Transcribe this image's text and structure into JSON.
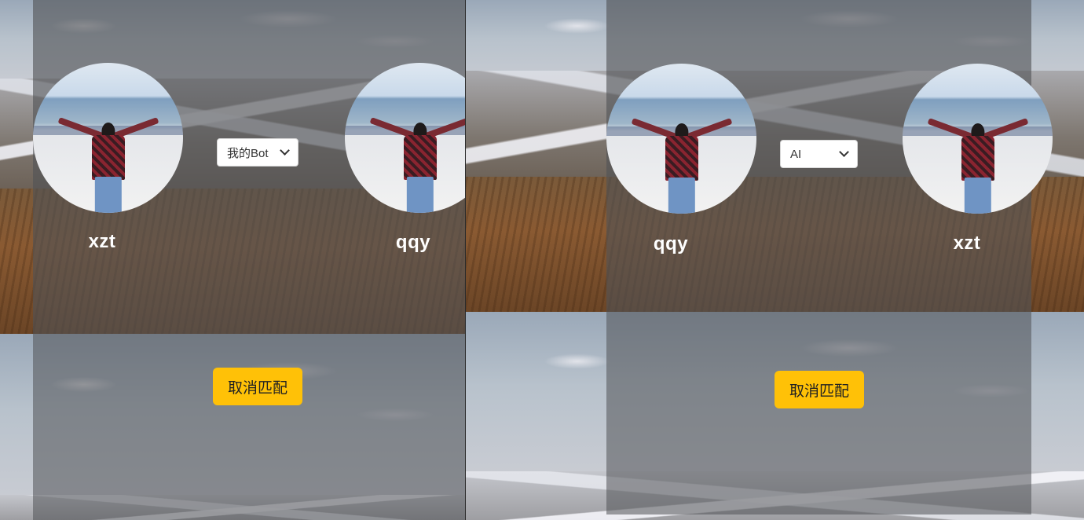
{
  "left_panel": {
    "player_one_name": "xzt",
    "player_two_name": "qqy",
    "mode_select": {
      "selected": "我的Bot"
    },
    "cancel_button_label": "取消匹配"
  },
  "right_panel": {
    "player_one_name": "qqy",
    "player_two_name": "xzt",
    "mode_select": {
      "selected": "AI"
    },
    "cancel_button_label": "取消匹配"
  },
  "colors": {
    "accent_button": "#ffc107",
    "overlay": "rgba(80,82,86,0.62)",
    "name_text": "#ffffff"
  },
  "icons": [
    "chevron-down-icon"
  ]
}
